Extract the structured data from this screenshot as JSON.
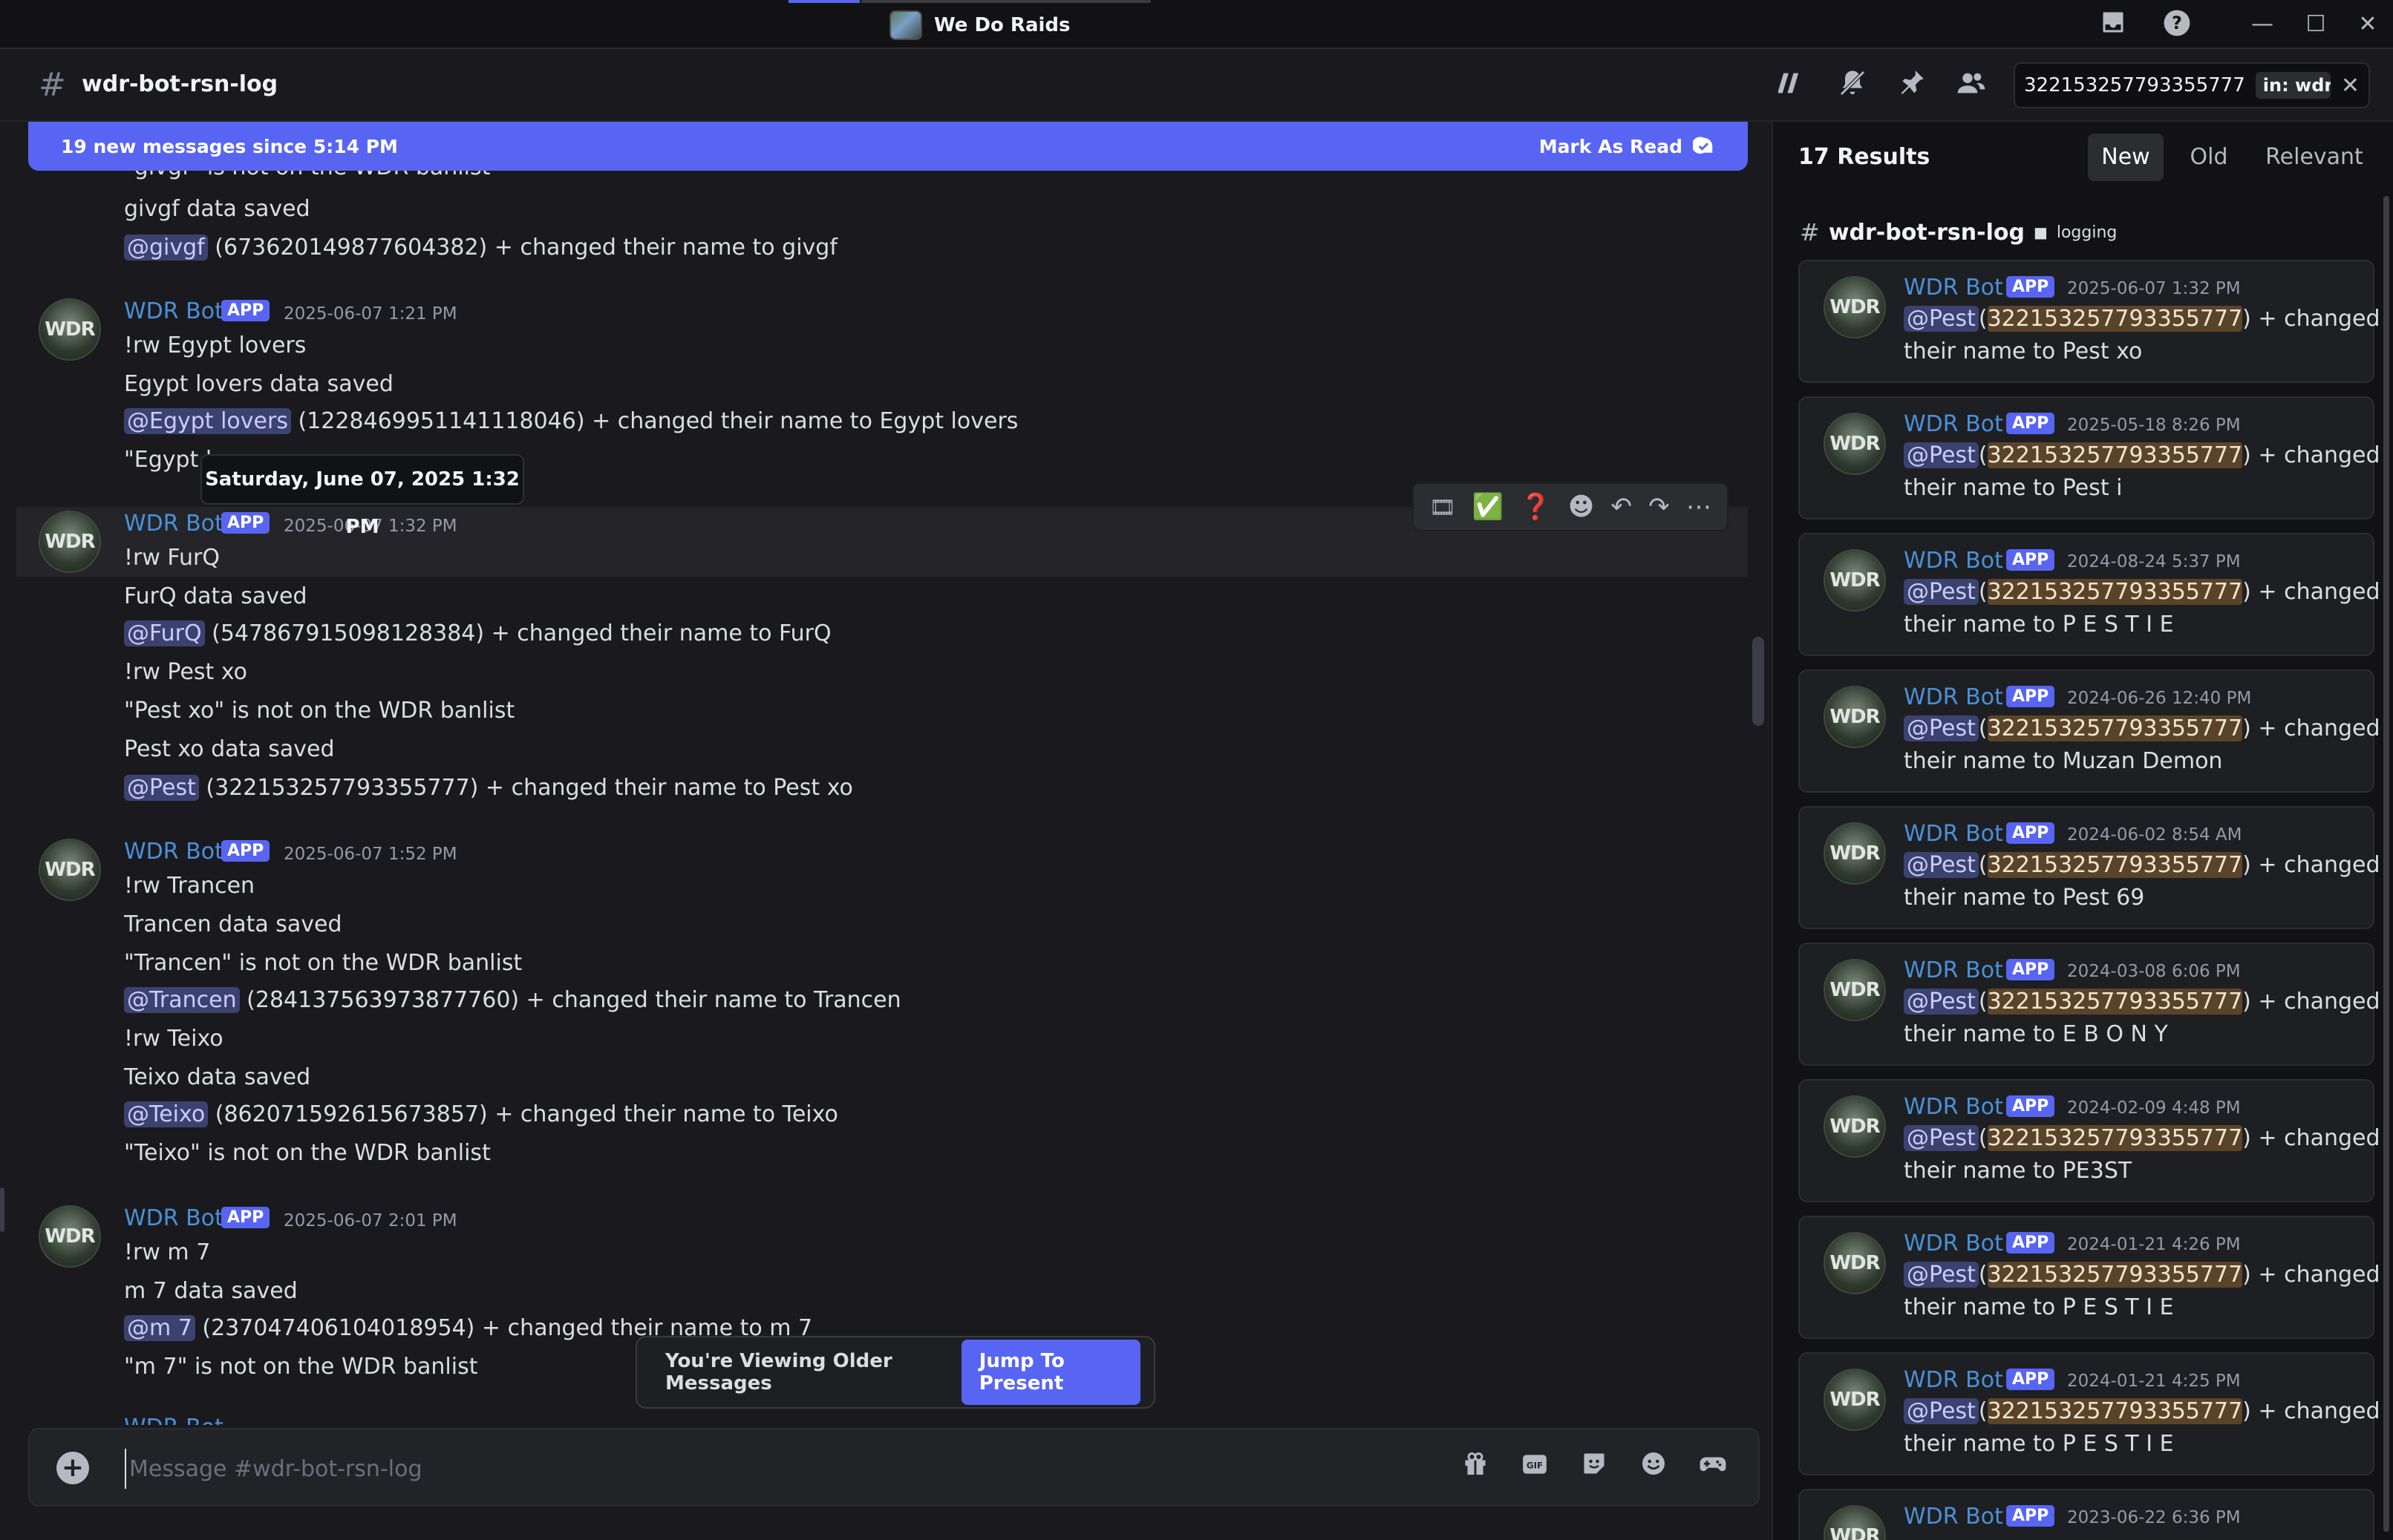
{
  "window": {
    "title": "We Do Raids",
    "icons": [
      "inbox-icon",
      "help-icon"
    ],
    "controls": [
      "minimize",
      "maximize",
      "close"
    ]
  },
  "channel": {
    "name": "wdr-bot-rsn-log"
  },
  "header_icons": [
    "threads-icon",
    "mute-icon",
    "pin-icon",
    "members-icon"
  ],
  "search": {
    "query": "322153257793355777",
    "filter": "in: wdr-bot-"
  },
  "banner": {
    "text": "19 new messages since 5:14 PM",
    "action": "Mark As Read"
  },
  "tooltip": "Saturday, June 07, 2025 1:32 PM",
  "top_fragment": {
    "line0": "\"givgf\" is not on the WDR banlist",
    "line1": "givgf data saved",
    "mention": "@givgf",
    "rest": " (673620149877604382) + changed their name to givgf"
  },
  "messages": [
    {
      "author": "WDR Bot",
      "badge": "APP",
      "time": "2025-06-07 1:21 PM",
      "lines": [
        {
          "text": "!rw Egypt lovers"
        },
        {
          "text": "Egypt lovers data saved"
        },
        {
          "mention": "@Egypt lovers",
          "text": " (1228469951141118046) + changed their name to Egypt lovers"
        },
        {
          "text": "\"Egypt l"
        }
      ]
    },
    {
      "author": "WDR Bot",
      "badge": "APP",
      "time": "2025-06-07 1:32 PM",
      "lines": [
        {
          "text": "!rw FurQ"
        },
        {
          "text": "FurQ data saved"
        },
        {
          "mention": "@FurQ",
          "text": " (547867915098128384) + changed their name to FurQ"
        },
        {
          "text": "!rw Pest xo"
        },
        {
          "text": "\"Pest xo\" is not on the WDR banlist"
        },
        {
          "text": "Pest xo data saved"
        },
        {
          "mention": "@Pest",
          "text": " (322153257793355777) + changed their name to Pest xo"
        }
      ]
    },
    {
      "author": "WDR Bot",
      "badge": "APP",
      "time": "2025-06-07 1:52 PM",
      "lines": [
        {
          "text": "!rw Trancen"
        },
        {
          "text": "Trancen data saved"
        },
        {
          "text": "\"Trancen\" is not on the WDR banlist"
        },
        {
          "mention": "@Trancen",
          "text": " (284137563973877760) + changed their name to Trancen"
        },
        {
          "text": "!rw Teixo"
        },
        {
          "text": "Teixo data saved"
        },
        {
          "mention": "@Teixo",
          "text": " (862071592615673857) + changed their name to Teixo"
        },
        {
          "text": "\"Teixo\" is not on the WDR banlist"
        }
      ]
    },
    {
      "author": "WDR Bot",
      "badge": "APP",
      "time": "2025-06-07 2:01 PM",
      "lines": [
        {
          "text": "!rw m 7"
        },
        {
          "text": "m 7 data saved"
        },
        {
          "mention": "@m 7",
          "text": " (237047406104018954) + changed their name to m 7"
        },
        {
          "text": "\"m 7\" is not on the WDR banlist"
        }
      ]
    }
  ],
  "partial_author": "WDR Bot",
  "message_actions": [
    "gif-reaction-icon",
    "check-reaction-icon",
    "question-reaction-icon",
    "add-reaction-icon",
    "reply-icon",
    "forward-icon",
    "more-icon"
  ],
  "older": {
    "text": "You're Viewing Older Messages",
    "button": "Jump To Present"
  },
  "composer": {
    "placeholder": "Message #wdr-bot-rsn-log",
    "icons": [
      "gift-icon",
      "gif-icon",
      "sticker-icon",
      "emoji-icon",
      "activity-icon"
    ]
  },
  "results": {
    "count": "17 Results",
    "sort_tabs": [
      "New",
      "Old",
      "Relevant"
    ],
    "active_sort": "New",
    "channel": "wdr-bot-rsn-log",
    "category": "logging",
    "avatar_text": "WDR",
    "items": [
      {
        "author": "WDR Bot",
        "badge": "APP",
        "time": "2025-06-07 1:32 PM",
        "mention": "@Pest",
        "id": "322153257793355777",
        "tail": ") + changed",
        "line2": "their name to Pest xo"
      },
      {
        "author": "WDR Bot",
        "badge": "APP",
        "time": "2025-05-18 8:26 PM",
        "mention": "@Pest",
        "id": "322153257793355777",
        "tail": ") + changed",
        "line2": "their name to Pest i"
      },
      {
        "author": "WDR Bot",
        "badge": "APP",
        "time": "2024-08-24 5:37 PM",
        "mention": "@Pest",
        "id": "322153257793355777",
        "tail": ") + changed",
        "line2": "their name to P E S T I E"
      },
      {
        "author": "WDR Bot",
        "badge": "APP",
        "time": "2024-06-26 12:40 PM",
        "mention": "@Pest",
        "id": "322153257793355777",
        "tail": ") + changed",
        "line2": "their name to Muzan Demon"
      },
      {
        "author": "WDR Bot",
        "badge": "APP",
        "time": "2024-06-02 8:54 AM",
        "mention": "@Pest",
        "id": "322153257793355777",
        "tail": ") + changed",
        "line2": "their name to Pest 69"
      },
      {
        "author": "WDR Bot",
        "badge": "APP",
        "time": "2024-03-08 6:06 PM",
        "mention": "@Pest",
        "id": "322153257793355777",
        "tail": ") + changed",
        "line2": "their name to E B O N Y"
      },
      {
        "author": "WDR Bot",
        "badge": "APP",
        "time": "2024-02-09 4:48 PM",
        "mention": "@Pest",
        "id": "322153257793355777",
        "tail": ") + changed",
        "line2": "their name to PE3ST"
      },
      {
        "author": "WDR Bot",
        "badge": "APP",
        "time": "2024-01-21 4:26 PM",
        "mention": "@Pest",
        "id": "322153257793355777",
        "tail": ") + changed",
        "line2": "their name to P E S T I E"
      },
      {
        "author": "WDR Bot",
        "badge": "APP",
        "time": "2024-01-21 4:25 PM",
        "mention": "@Pest",
        "id": "322153257793355777",
        "tail": ") + changed",
        "line2": "their name to P E S T I E"
      },
      {
        "author": "WDR Bot",
        "badge": "APP",
        "time": "2023-06-22 6:36 PM",
        "mention": "",
        "id": "",
        "tail": "",
        "line2": ""
      }
    ]
  },
  "colors": {
    "accent": "#5865f2",
    "author": "#4a90d9",
    "highlight": "#5a4429"
  }
}
